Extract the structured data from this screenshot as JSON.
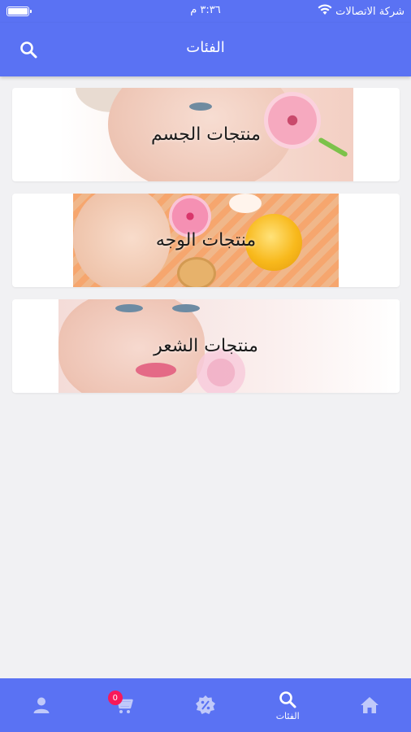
{
  "status_bar": {
    "carrier": "شركة الاتصالات",
    "time": "٣:٣٦ م",
    "battery_level": 1.0
  },
  "header": {
    "title": "الفئات",
    "search_icon": "search-icon"
  },
  "categories": [
    {
      "label": "منتجات الجسم"
    },
    {
      "label": "منتجات الوجه"
    },
    {
      "label": "منتجات الشعر"
    }
  ],
  "bottom_nav": {
    "items": [
      {
        "icon": "home-icon",
        "label": ""
      },
      {
        "icon": "search-icon",
        "label": "الفئات",
        "active": true
      },
      {
        "icon": "discount-badge-icon",
        "label": ""
      },
      {
        "icon": "cart-icon",
        "label": "",
        "badge": "0"
      },
      {
        "icon": "user-icon",
        "label": ""
      }
    ]
  },
  "colors": {
    "primary": "#5a72f3",
    "background": "#f1f1f3",
    "badge": "#f8195a"
  }
}
